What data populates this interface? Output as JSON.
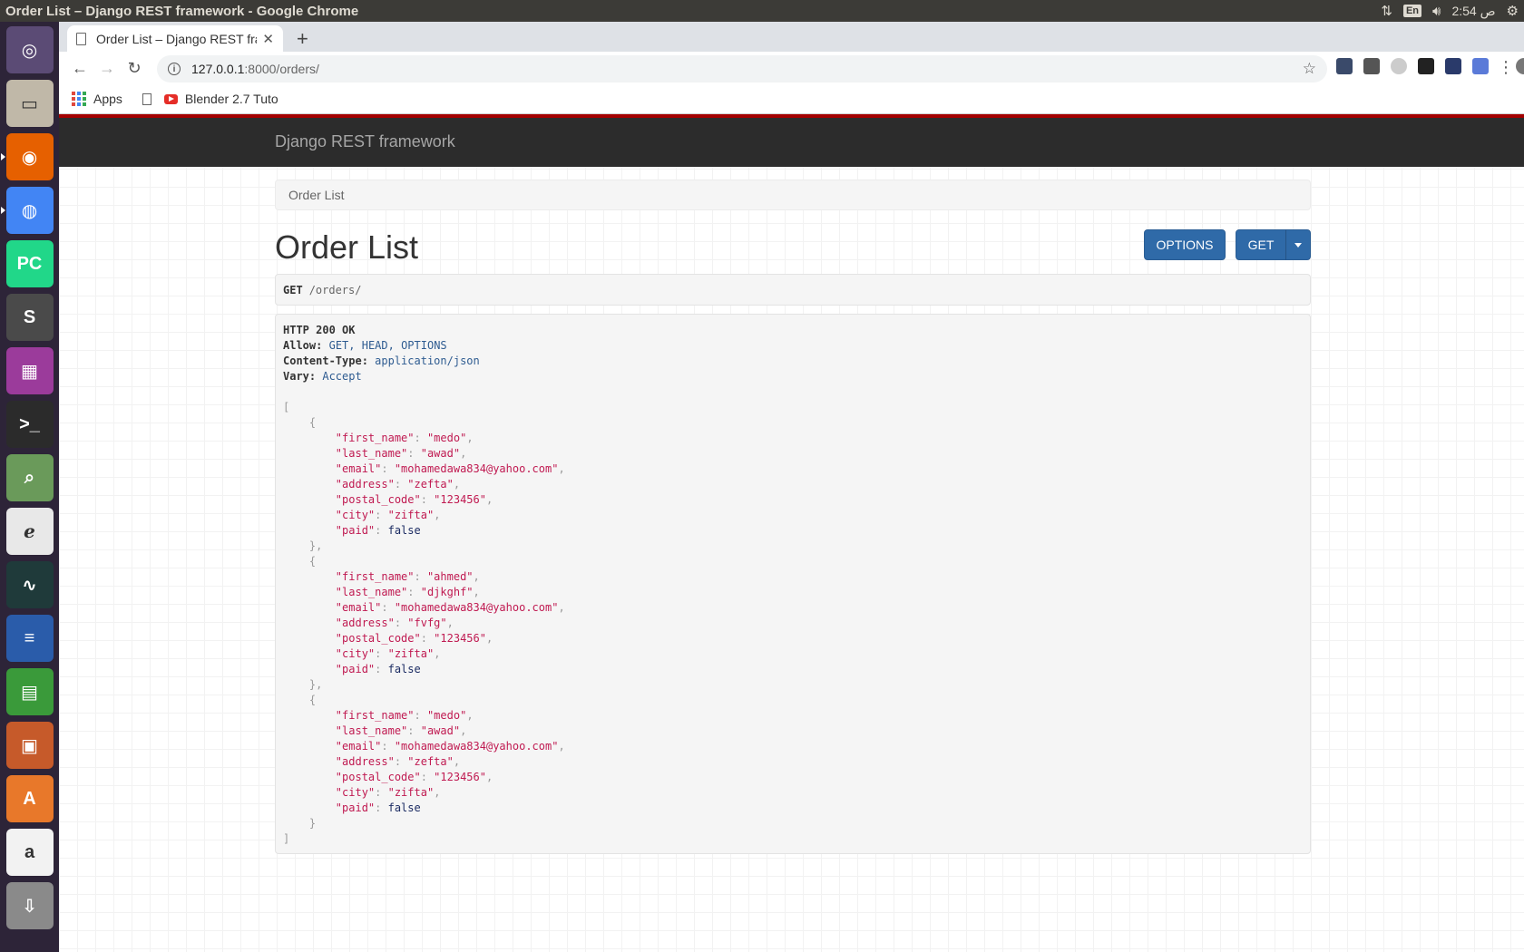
{
  "os": {
    "window_title": "Order List – Django REST framework - Google Chrome",
    "lang": "En",
    "clock": "2:54 ص"
  },
  "launcher": {
    "apps": [
      {
        "name": "ubuntu-dash-icon",
        "color": "#5b4b75",
        "glyph": "◎"
      },
      {
        "name": "files-icon",
        "color": "#c0b8a8",
        "glyph": "▭"
      },
      {
        "name": "firefox-icon",
        "color": "#e66000",
        "glyph": "◉",
        "running": true
      },
      {
        "name": "chrome-icon",
        "color": "#4285f4",
        "glyph": "◍",
        "running": true
      },
      {
        "name": "pycharm-icon",
        "color": "#21d789",
        "glyph": "PC"
      },
      {
        "name": "sublime-icon",
        "color": "#4a4a4a",
        "glyph": "S"
      },
      {
        "name": "app-window-icon",
        "color": "#9b3b9b",
        "glyph": "▦"
      },
      {
        "name": "terminal-icon",
        "color": "#2b2b2b",
        "glyph": ">_"
      },
      {
        "name": "image-viewer-icon",
        "color": "#6a9a5a",
        "glyph": "⌕"
      },
      {
        "name": "document-viewer-icon",
        "color": "#e8e8e8",
        "glyph": "ℯ"
      },
      {
        "name": "system-monitor-icon",
        "color": "#1f3a3a",
        "glyph": "∿"
      },
      {
        "name": "writer-icon",
        "color": "#2a5caa",
        "glyph": "≡"
      },
      {
        "name": "calc-icon",
        "color": "#3a9a3a",
        "glyph": "▤"
      },
      {
        "name": "impress-icon",
        "color": "#c65a2a",
        "glyph": "▣"
      },
      {
        "name": "software-center-icon",
        "color": "#e8782a",
        "glyph": "A"
      },
      {
        "name": "amazon-icon",
        "color": "#f2f2f2",
        "glyph": "a"
      },
      {
        "name": "installer-icon",
        "color": "#8a8a8a",
        "glyph": "⇩"
      }
    ]
  },
  "browser": {
    "tab_title": "Order List – Django REST framework",
    "url_host": "127.0.0.1",
    "url_rest": ":8000/orders/",
    "bookmarks": {
      "apps_label": "Apps",
      "blender_label": "Blender 2.7 Tuto"
    }
  },
  "page": {
    "brand": "Django REST framework",
    "breadcrumb": "Order List",
    "title": "Order List",
    "options_label": "OPTIONS",
    "get_label": "GET",
    "request_method": "GET",
    "request_path": "/orders/",
    "response": {
      "status": "HTTP 200 OK",
      "headers": [
        {
          "key": "Allow:",
          "value": "GET, HEAD, OPTIONS"
        },
        {
          "key": "Content-Type:",
          "value": "application/json"
        },
        {
          "key": "Vary:",
          "value": "Accept"
        }
      ],
      "orders": [
        {
          "first_name": "medo",
          "last_name": "awad",
          "email": "mohamedawa834@yahoo.com",
          "address": "zefta",
          "postal_code": "123456",
          "city": "zifta",
          "paid": false
        },
        {
          "first_name": "ahmed",
          "last_name": "djkghf",
          "email": "mohamedawa834@yahoo.com",
          "address": "fvfg",
          "postal_code": "123456",
          "city": "zifta",
          "paid": false
        },
        {
          "first_name": "medo",
          "last_name": "awad",
          "email": "mohamedawa834@yahoo.com",
          "address": "zefta",
          "postal_code": "123456",
          "city": "zifta",
          "paid": false
        }
      ]
    }
  },
  "colors": {
    "navbar": "#2c2c2c",
    "navbar_accent": "#a30000",
    "button": "#2f6aa8",
    "json_string": "#c01a51"
  }
}
